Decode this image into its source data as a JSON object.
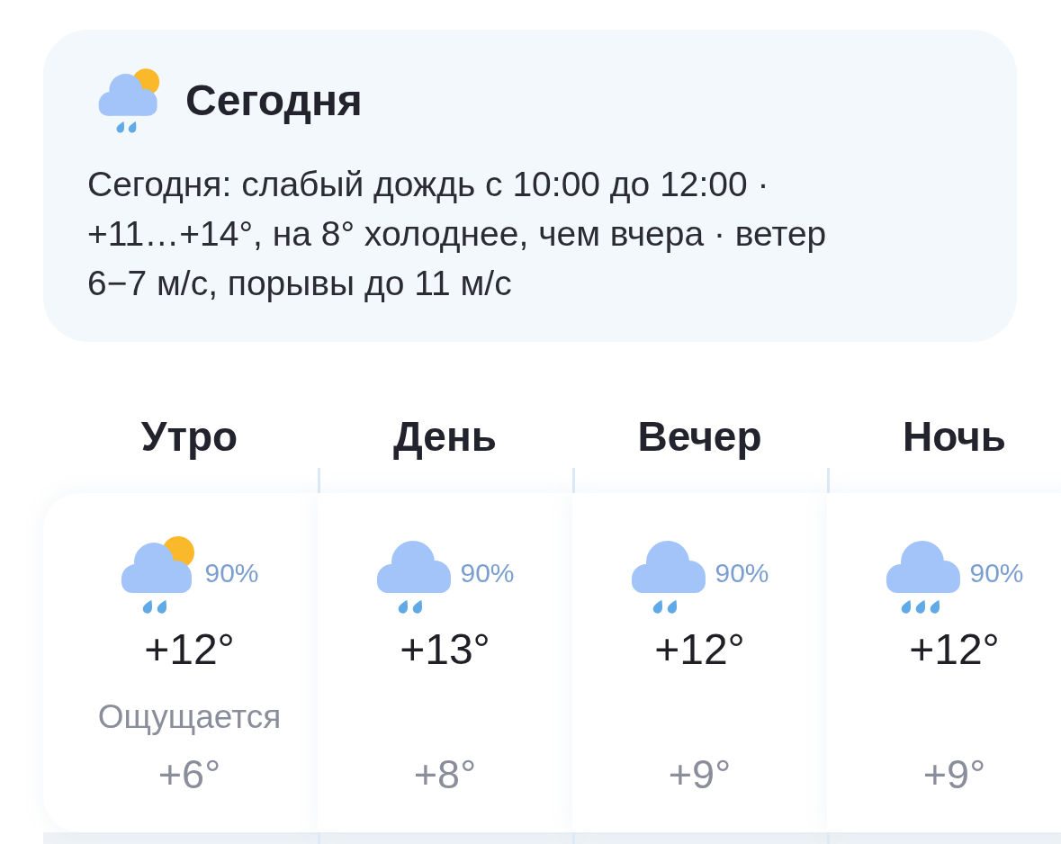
{
  "today": {
    "kind": "partly-cloudy-light-rain",
    "title": "Сегодня",
    "summary": "Сегодня: слабый дождь с 10:00 до 12:00 · +11…+14°, на 8° холоднее, чем вчера · ветер 6−7 м/с, порывы до 11 м/с"
  },
  "periods": [
    {
      "label": "Утро",
      "kind": "partly-cloudy-light-rain",
      "precipitation": "90%",
      "temperature": "+12°",
      "feels_like_label": "Ощущается",
      "feels_like": "+6°"
    },
    {
      "label": "День",
      "kind": "cloudy-light-rain",
      "precipitation": "90%",
      "temperature": "+13°",
      "feels_like": "+8°"
    },
    {
      "label": "Вечер",
      "kind": "cloudy-light-rain",
      "precipitation": "90%",
      "temperature": "+12°",
      "feels_like": "+9°"
    },
    {
      "label": "Ночь",
      "kind": "cloudy-rain",
      "precipitation": "90%",
      "temperature": "+12°",
      "feels_like": "+9°"
    }
  ]
}
